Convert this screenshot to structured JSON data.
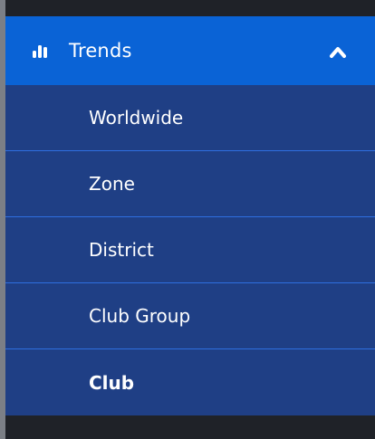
{
  "menu": {
    "section_label": "Trends",
    "section_icon": "bar-chart-icon",
    "toggle_icon": "chevron-up-icon",
    "items": [
      {
        "label": "Worldwide",
        "active": false
      },
      {
        "label": "Zone",
        "active": false
      },
      {
        "label": "District",
        "active": false
      },
      {
        "label": "Club Group",
        "active": false
      },
      {
        "label": "Club",
        "active": true
      }
    ]
  },
  "colors": {
    "header_bg": "#0a63d6",
    "submenu_bg": "#1f3f85",
    "divider": "#2f6fe0",
    "frame_dark": "#1f2228",
    "text": "#ffffff"
  }
}
